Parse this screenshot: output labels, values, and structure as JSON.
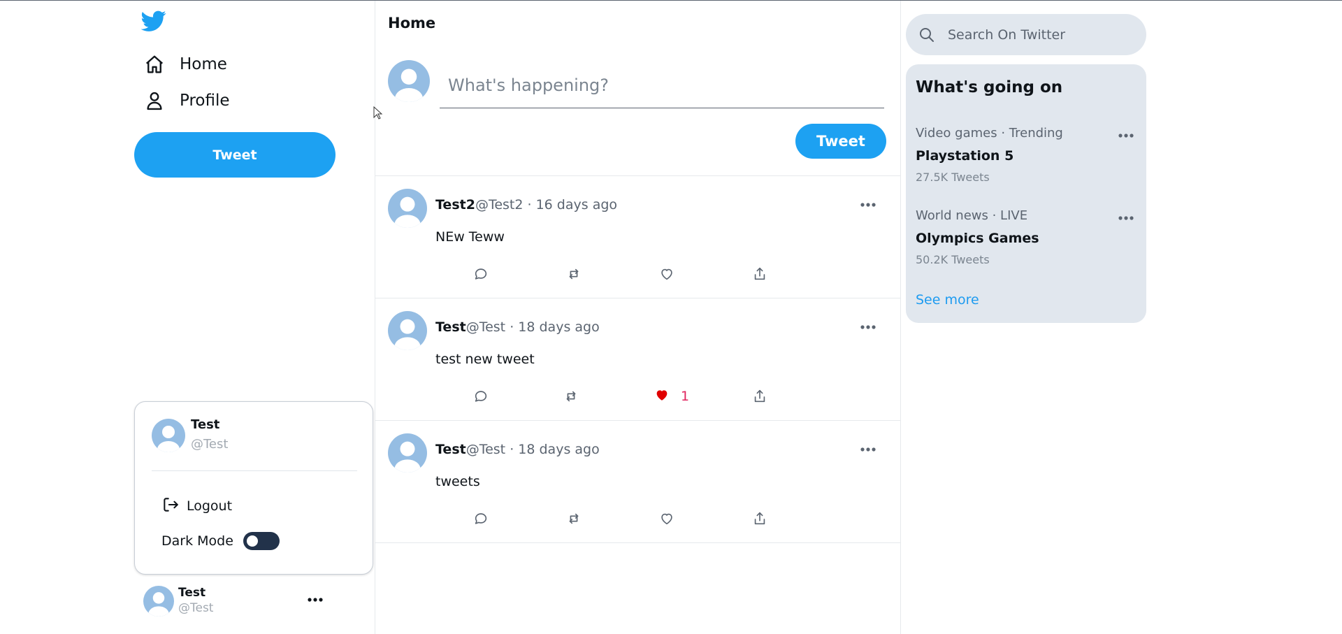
{
  "colors": {
    "brand": "#1da1f2",
    "like_red": "#e0245e",
    "panel_bg": "#e1e7ee",
    "avatar_blue": "#95bde3"
  },
  "sidebar": {
    "nav": [
      {
        "label": "Home",
        "icon": "home-icon"
      },
      {
        "label": "Profile",
        "icon": "user-icon"
      }
    ],
    "tweet_button": "Tweet",
    "account_popup": {
      "name": "Test",
      "handle": "@Test",
      "logout_label": "Logout",
      "dark_mode_label": "Dark Mode",
      "dark_mode_on": false
    },
    "account": {
      "name": "Test",
      "handle": "@Test"
    }
  },
  "main": {
    "title": "Home",
    "compose": {
      "placeholder": "What's happening?",
      "tweet_button": "Tweet"
    },
    "tweets": [
      {
        "name": "Test2",
        "handle": "@Test2",
        "dot": "·",
        "time": "16 days ago",
        "text": "NEw Teww",
        "liked": false,
        "likes": ""
      },
      {
        "name": "Test",
        "handle": "@Test",
        "dot": "·",
        "time": "18 days ago",
        "text": "test new tweet",
        "liked": true,
        "likes": "1"
      },
      {
        "name": "Test",
        "handle": "@Test",
        "dot": "·",
        "time": "18 days ago",
        "text": "tweets",
        "liked": false,
        "likes": ""
      }
    ]
  },
  "right": {
    "search": {
      "placeholder": "Search On Twitter"
    },
    "trends": {
      "title": "What's going on",
      "items": [
        {
          "meta": "Video games · Trending",
          "topic": "Playstation 5",
          "count": "27.5K Tweets"
        },
        {
          "meta": "World news · LIVE",
          "topic": "Olympics Games",
          "count": "50.2K Tweets"
        }
      ],
      "see_more": "See more"
    }
  }
}
